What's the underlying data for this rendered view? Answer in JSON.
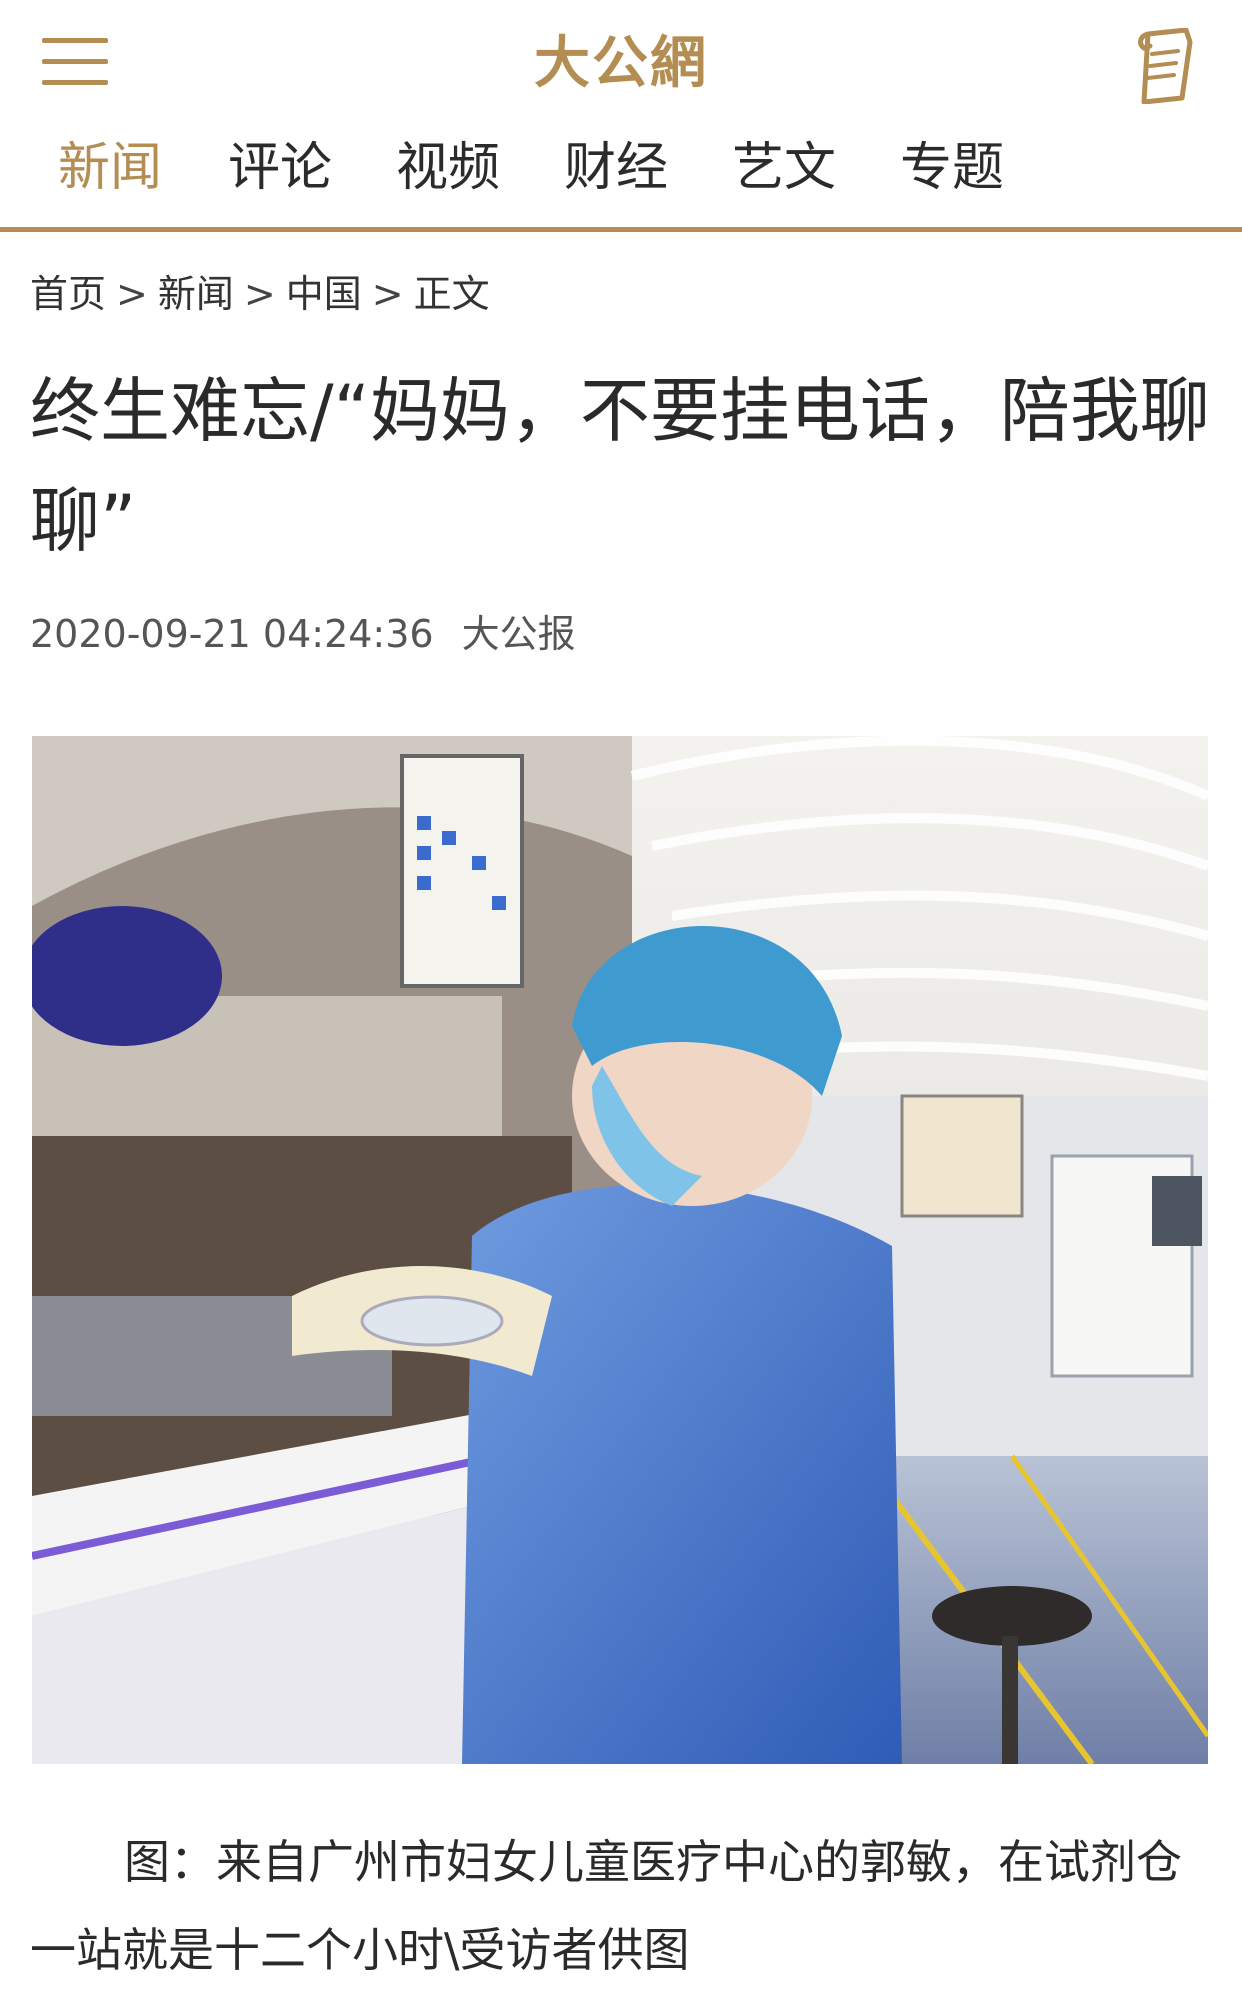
{
  "header": {
    "logo_text": "大公網",
    "menu_icon": "hamburger-menu-icon",
    "right_icon": "newspaper-icon",
    "accent_color": "#b48d52"
  },
  "nav": {
    "items": [
      {
        "label": "新闻",
        "active": true
      },
      {
        "label": "评论",
        "active": false
      },
      {
        "label": "视频",
        "active": false
      },
      {
        "label": "财经",
        "active": false
      },
      {
        "label": "艺文",
        "active": false
      },
      {
        "label": "专题",
        "active": false
      }
    ]
  },
  "breadcrumb": {
    "items": [
      "首页",
      "新闻",
      "中国",
      "正文"
    ],
    "separator": ">"
  },
  "article": {
    "title": "终生难忘/“妈妈，不要挂电话，陪我聊聊”",
    "datetime": "2020-09-21 04:24:36",
    "source": "大公报",
    "caption": "图：来自广州市妇女儿童医疗中心的郭敏，在试剂仓一站就是十二个小时\\受访者供图"
  }
}
